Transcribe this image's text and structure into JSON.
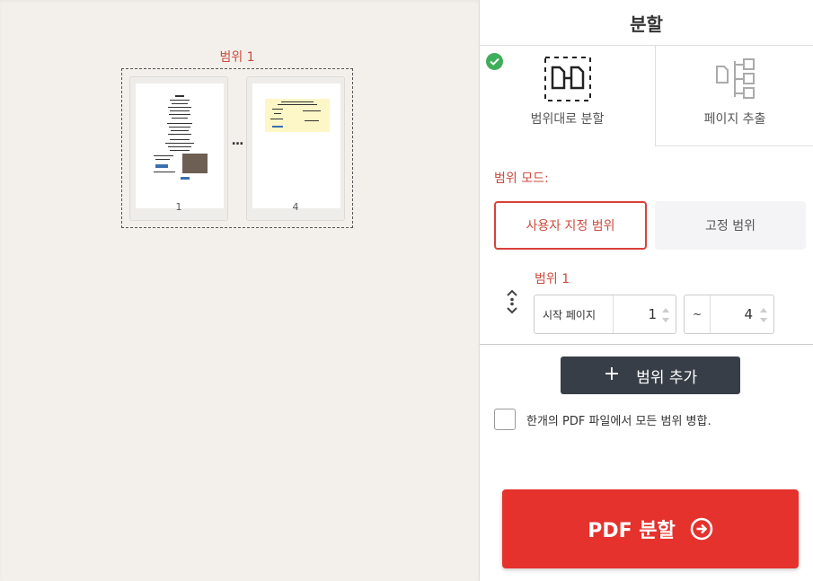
{
  "preview": {
    "range_title": "범위 1",
    "pages": [
      {
        "number": "1"
      },
      {
        "number": "4"
      }
    ],
    "ellipsis": "..."
  },
  "sidebar": {
    "title": "분할",
    "tabs": [
      {
        "label": "범위대로 분할",
        "icon": "split-range-icon",
        "selected": true
      },
      {
        "label": "페이지 추출",
        "icon": "extract-pages-icon",
        "selected": false
      }
    ],
    "mode_label": "범위 모드:",
    "modes": [
      {
        "label": "사용자 지정 범위",
        "active": true
      },
      {
        "label": "고정 범위",
        "active": false
      }
    ],
    "range": {
      "label": "범위 1",
      "start_prefix": "시작 페이지",
      "start_value": "1",
      "end_prefix": "~",
      "end_value": "4"
    },
    "add_range_label": "범위 추가",
    "merge_label": "한개의 PDF 파일에서 모든 범위 병합.",
    "split_button_label": "PDF 분할"
  },
  "colors": {
    "accent_red": "#e5322d",
    "label_red": "#cb4b3e",
    "dark_button": "#383e47",
    "check_green": "#3fae5a"
  }
}
